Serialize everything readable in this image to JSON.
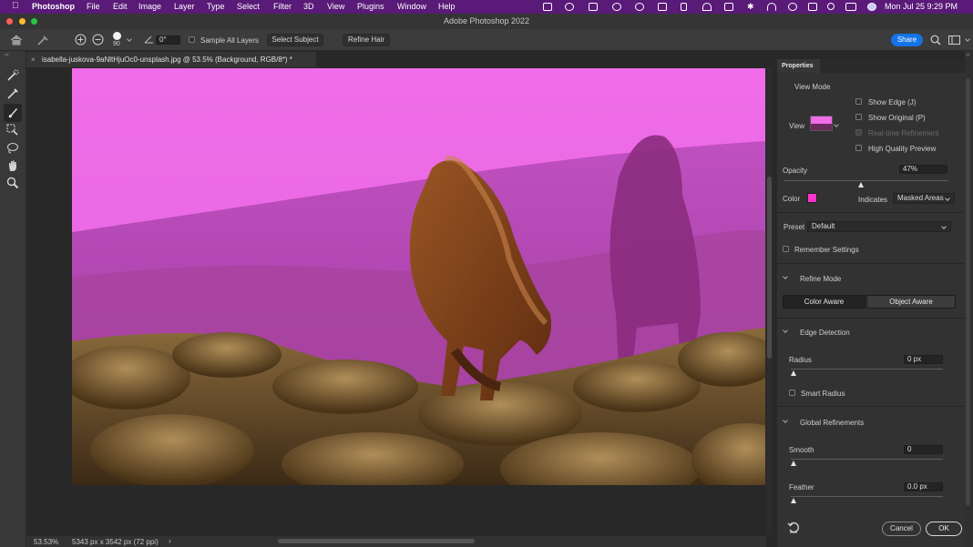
{
  "menubar": {
    "app": "Photoshop",
    "items": [
      "File",
      "Edit",
      "Image",
      "Layer",
      "Type",
      "Select",
      "Filter",
      "3D",
      "View",
      "Plugins",
      "Window",
      "Help"
    ],
    "datetime": "Mon Jul 25  9:29 PM"
  },
  "window": {
    "title": "Adobe Photoshop 2022"
  },
  "options": {
    "brush_size": "90",
    "angle": "0°",
    "sample_all_layers": "Sample All Layers",
    "select_subject": "Select Subject",
    "refine_hair": "Refine Hair",
    "share": "Share"
  },
  "document": {
    "tab_title": "isabella-juskova-9aNltHjuOc0-unsplash.jpg @ 53.5% (Background, RGB/8*) *"
  },
  "status": {
    "zoom": "53.53%",
    "size": "5343 px x 3542 px (72 ppi)"
  },
  "properties": {
    "title": "Properties",
    "view_mode": "View Mode",
    "view": "View",
    "show_edge": "Show Edge (J)",
    "show_original": "Show Original (P)",
    "realtime_refinement": "Real-time Refinement",
    "high_quality_preview": "High Quality Preview",
    "opacity_label": "Opacity",
    "opacity_value": "47%",
    "opacity_level": 0.47,
    "color_label": "Color",
    "overlay_color": "#ff33cc",
    "indicates_label": "Indicates",
    "indicates_value": "Masked Areas",
    "preset_label": "Preset",
    "preset_value": "Default",
    "remember_settings": "Remember Settings",
    "refine_mode": "Refine Mode",
    "color_aware": "Color Aware",
    "object_aware": "Object Aware",
    "edge_detection": "Edge Detection",
    "radius_label": "Radius",
    "radius_value": "0 px",
    "smart_radius": "Smart Radius",
    "global_refinements": "Global Refinements",
    "smooth_label": "Smooth",
    "smooth_value": "0",
    "feather_label": "Feather",
    "feather_value": "0.0 px",
    "cancel": "Cancel",
    "ok": "OK"
  }
}
